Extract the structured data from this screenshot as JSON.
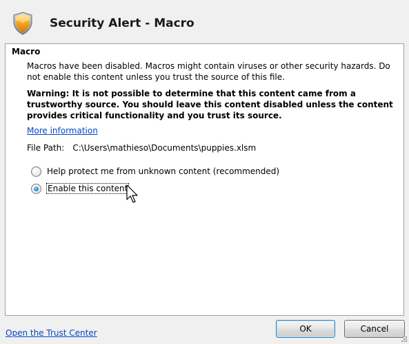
{
  "window": {
    "title": "Security Alert - Macro"
  },
  "colors": {
    "link": "#0046c7",
    "accent": "#1c78c8"
  },
  "icons": {
    "header": "shield-warning-icon",
    "pointer": "mouse-pointer-icon"
  },
  "group": {
    "title": "Macro",
    "description": "Macros have been disabled. Macros might contain viruses or other security hazards. Do not enable this content unless you trust the source of this file.",
    "warning": "Warning: It is not possible to determine that this content came from a trustworthy source. You should leave this content disabled unless the content provides critical functionality and you trust its source.",
    "more_info_link": "More information",
    "file_path_label": "File Path:",
    "file_path_value": "C:\\Users\\mathieso\\Documents\\puppies.xlsm",
    "options": [
      {
        "label": "Help protect me from unknown content (recommended)",
        "selected": false
      },
      {
        "label": "Enable this content",
        "selected": true
      }
    ]
  },
  "footer": {
    "trust_center_link": "Open the Trust Center",
    "ok_label": "OK",
    "cancel_label": "Cancel"
  }
}
